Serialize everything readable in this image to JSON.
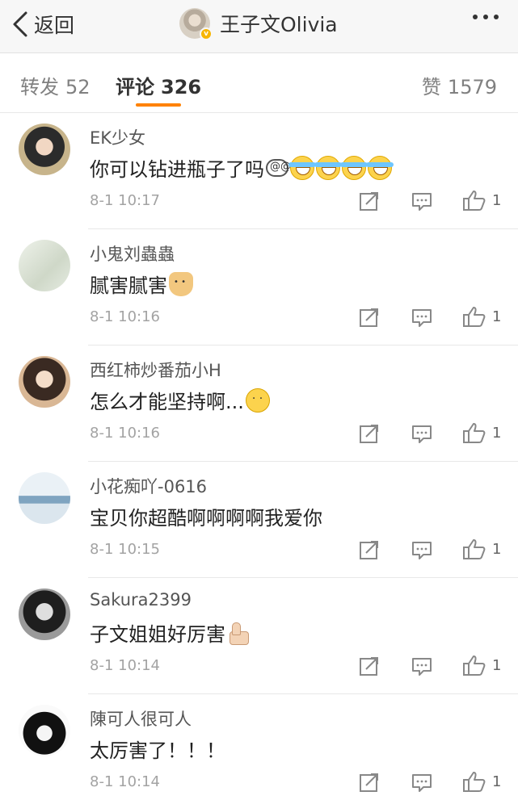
{
  "header": {
    "back_label": "返回",
    "title": "王子文Olivia"
  },
  "tabs": {
    "repost": {
      "label": "转发",
      "count": "52"
    },
    "comment": {
      "label": "评论",
      "count": "326"
    },
    "like": {
      "label": "赞",
      "count": "1579"
    }
  },
  "colors": {
    "accent": "#ff8200",
    "verified_badge": "#f7b500"
  },
  "icons": [
    "back-chevron-icon",
    "more-dots-icon",
    "share-icon",
    "reply-icon",
    "like-thumb-icon"
  ],
  "comments": [
    {
      "user": "EK少女",
      "text": "你可以钻进瓶子了吗",
      "emojis": [
        "dizzy",
        "laugh",
        "laugh",
        "laugh",
        "laugh"
      ],
      "time": "8-1 10:17",
      "likes": "1"
    },
    {
      "user": "小鬼刘蟲蟲",
      "text": "腻害腻害",
      "emojis": [
        "doge"
      ],
      "time": "8-1 10:16",
      "likes": "1"
    },
    {
      "user": "西红柿炒番茄小H",
      "text": "怎么才能坚持啊...",
      "emojis": [
        "think"
      ],
      "time": "8-1 10:16",
      "likes": "1"
    },
    {
      "user": "小花痴吖-0616",
      "text": "宝贝你超酷啊啊啊啊我爱你",
      "emojis": [],
      "time": "8-1 10:15",
      "likes": "1"
    },
    {
      "user": "Sakura2399",
      "text": "子文姐姐好厉害",
      "emojis": [
        "thumb"
      ],
      "time": "8-1 10:14",
      "likes": "1"
    },
    {
      "user": "陳可人很可人",
      "text": "太厉害了！！！",
      "emojis": [],
      "time": "8-1 10:14",
      "likes": "1"
    }
  ]
}
